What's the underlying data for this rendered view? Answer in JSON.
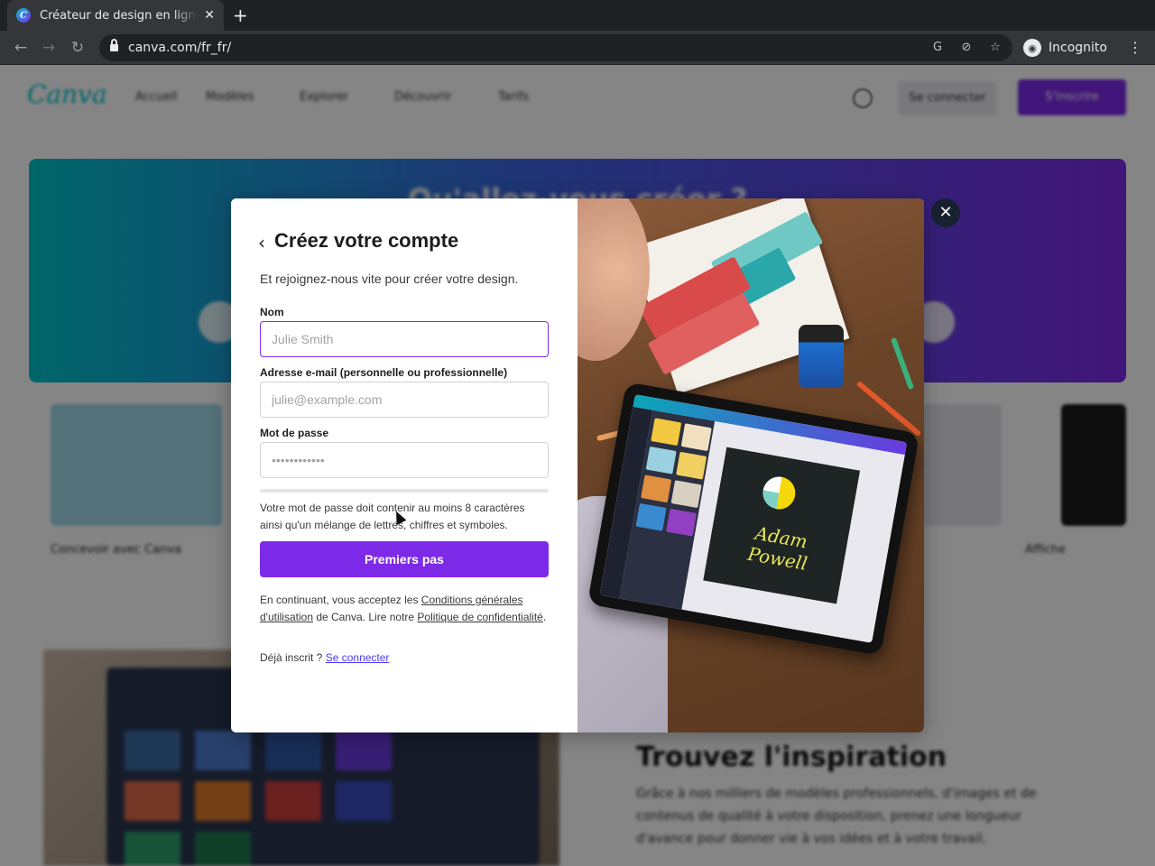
{
  "browser": {
    "tab_title": "Créateur de design en ligne",
    "favicon_letter": "C",
    "tab_close": "✕",
    "new_tab": "+",
    "back": "←",
    "forward": "→",
    "reload": "↻",
    "url": "canva.com/fr_fr/",
    "translate_icon": "G",
    "eye_icon": "⊘",
    "star_icon": "☆",
    "incognito_label": "Incognito",
    "incognito_icon": "◉",
    "menu": "⋮"
  },
  "background": {
    "logo": "Canva",
    "nav": [
      "Accueil",
      "Modèles",
      "Explorer",
      "Découvrir",
      "Tarifs"
    ],
    "login": "Se connecter",
    "signup": "S'inscrire",
    "hero_title": "Qu'allez-vous créer ?",
    "card_labels": [
      "Concevoir avec Canva",
      "Affiche"
    ],
    "inspiration_title": "Trouvez l'inspiration",
    "inspiration_text": "Grâce à nos milliers de modèles professionnels, d'images et de contenus de qualité à votre disposition, prenez une longueur d'avance pour donner vie à vos idées et à votre travail."
  },
  "modal": {
    "back_icon": "‹",
    "title": "Créez votre compte",
    "subtitle": "Et rejoignez-nous vite pour créer votre design.",
    "name_label": "Nom",
    "name_placeholder": "Julie Smith",
    "email_label": "Adresse e-mail (personnelle ou professionnelle)",
    "email_placeholder": "julie@example.com",
    "password_label": "Mot de passe",
    "password_placeholder": "••••••••••••",
    "password_hint": "Votre mot de passe doit contenir au moins 8 caractères ainsi qu'un mélange de lettres, chiffres et symboles.",
    "submit": "Premiers pas",
    "terms_prefix": "En continuant, vous acceptez les ",
    "terms_link": "Conditions générales d'utilisation",
    "terms_middle": " de Canva. Lire notre ",
    "privacy_link": "Politique de confidentialité",
    "terms_suffix": ".",
    "already": "Déjà inscrit ? ",
    "signin_link": "Se connecter",
    "close": "✕",
    "tablet_text": "Adam Powell"
  }
}
